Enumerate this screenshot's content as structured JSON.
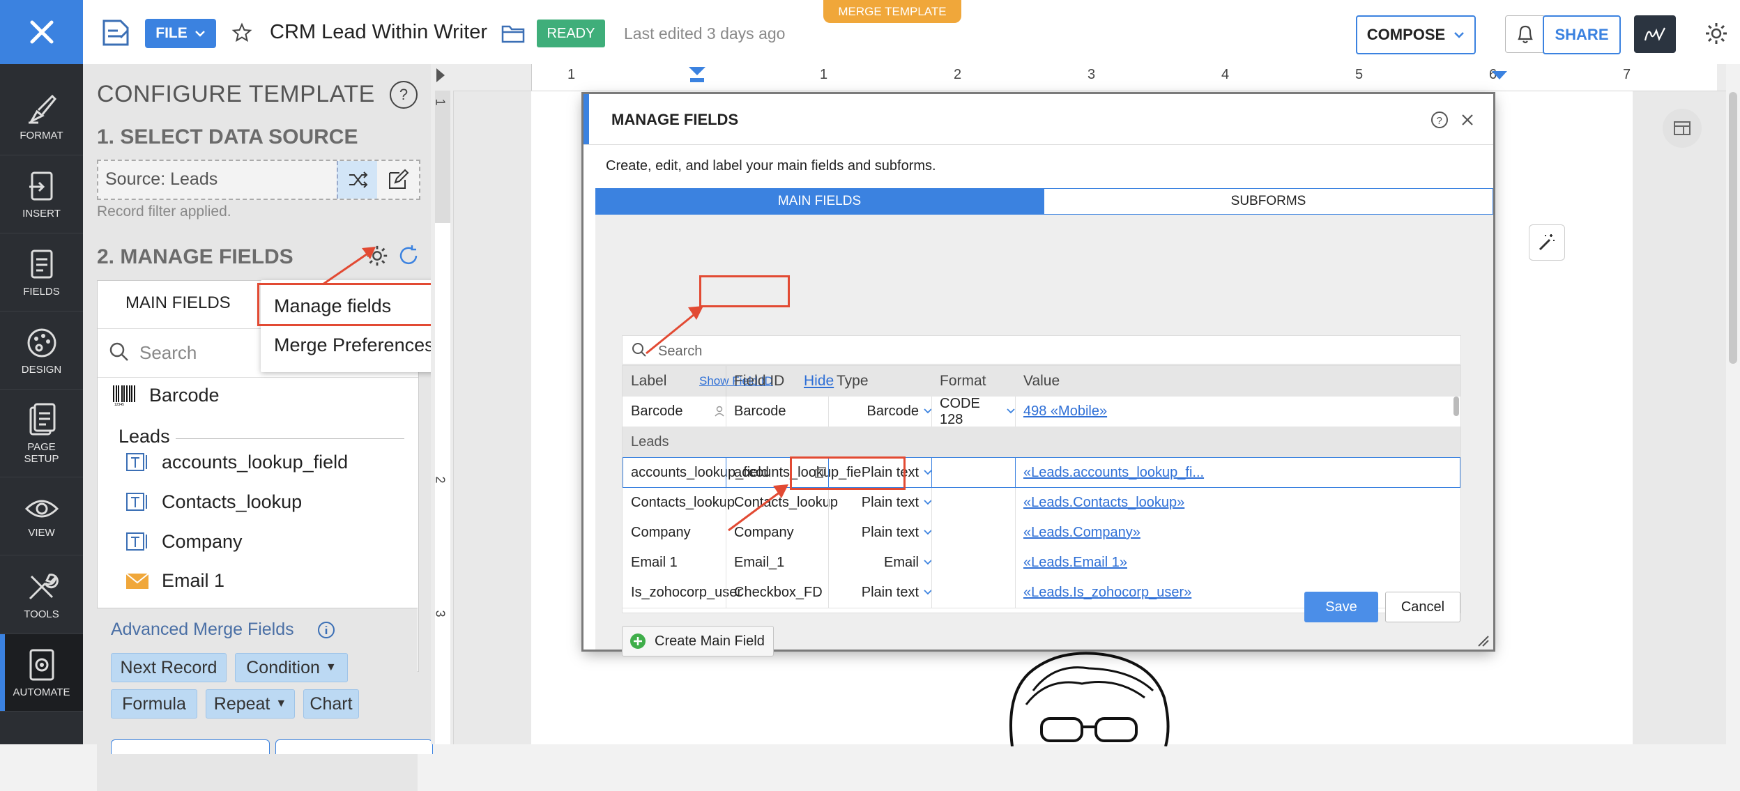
{
  "rail": {
    "items": [
      {
        "label": "FORMAT",
        "icon": "format-brush-icon"
      },
      {
        "label": "INSERT",
        "icon": "insert-icon"
      },
      {
        "label": "FIELDS",
        "icon": "fields-icon"
      },
      {
        "label": "DESIGN",
        "icon": "palette-icon"
      },
      {
        "label": "PAGE\nSETUP",
        "icon": "page-setup-icon"
      },
      {
        "label": "VIEW",
        "icon": "eye-icon"
      },
      {
        "label": "TOOLS",
        "icon": "tools-icon"
      },
      {
        "label": "AUTOMATE",
        "icon": "automate-icon"
      }
    ]
  },
  "topbar": {
    "file_label": "FILE",
    "doc_title": "CRM Lead Within Writer",
    "status_badge": "READY",
    "last_edited": "Last edited 3 days ago",
    "merge_tab": "MERGE TEMPLATE",
    "compose_label": "COMPOSE",
    "share_label": "SHARE"
  },
  "panel": {
    "title": "CONFIGURE TEMPLATE",
    "help": "?",
    "step1": "1. SELECT DATA SOURCE",
    "source_label": "Source:  Leads",
    "filter_note": "Record filter applied.",
    "step2": "2. MANAGE FIELDS",
    "tab_main": "MAIN FIELDS",
    "search_placeholder": "Search",
    "barcode": "Barcode",
    "group": "Leads",
    "fields": [
      "accounts_lookup_field",
      "Contacts_lookup",
      "Company",
      "Email 1"
    ],
    "advanced_title": "Advanced Merge Fields",
    "tags": {
      "next_record": "Next Record",
      "condition": "Condition",
      "formula": "Formula",
      "repeat": "Repeat",
      "chart": "Chart"
    }
  },
  "menu": {
    "manage_fields": "Manage fields",
    "merge_preferences": "Merge Preferences"
  },
  "ruler": {
    "top_numbers": [
      "1",
      "1",
      "2",
      "3",
      "4",
      "5",
      "6",
      "7"
    ],
    "left_numbers": [
      "1",
      "2",
      "3"
    ]
  },
  "dialog": {
    "title": "MANAGE FIELDS",
    "subtitle": "Create, edit, and label your main fields and subforms.",
    "tab_main": "MAIN FIELDS",
    "tab_sub": "SUBFORMS",
    "search_placeholder": "Search",
    "headers": {
      "label": "Label",
      "show_id": "Show Field ID",
      "field_id": "Field ID",
      "hide": "Hide",
      "type": "Type",
      "format": "Format",
      "value": "Value"
    },
    "barcode_row": {
      "label": "Barcode",
      "field_id": "Barcode",
      "type": "Barcode",
      "format": "CODE 128",
      "value": "498 «Mobile»"
    },
    "group": "Leads",
    "rows": [
      {
        "label": "accounts_lookup_field",
        "field_id": "accounts_lookup_fie",
        "type": "Plain text",
        "format": "",
        "value": "«Leads.accounts_lookup_fi..."
      },
      {
        "label": "Contacts_lookup",
        "field_id": "Contacts_lookup",
        "type": "Plain text",
        "format": "",
        "value": "«Leads.Contacts_lookup»"
      },
      {
        "label": "Company",
        "field_id": "Company",
        "type": "Plain text",
        "format": "",
        "value": "«Leads.Company»"
      },
      {
        "label": "Email 1",
        "field_id": "Email_1",
        "type": "Email",
        "format": "",
        "value": "«Leads.Email 1»"
      },
      {
        "label": "Is_zohocorp_user",
        "field_id": "Checkbox_FD",
        "type": "Plain text",
        "format": "",
        "value": "«Leads.Is_zohocorp_user»"
      }
    ],
    "create_label": "Create Main Field",
    "save_label": "Save",
    "cancel_label": "Cancel"
  },
  "colors": {
    "accent": "#3b82e0",
    "rail": "#2b2e33",
    "ready": "#3fae7a",
    "annotation": "#e24a33",
    "merge_tab": "#f0a73a"
  }
}
